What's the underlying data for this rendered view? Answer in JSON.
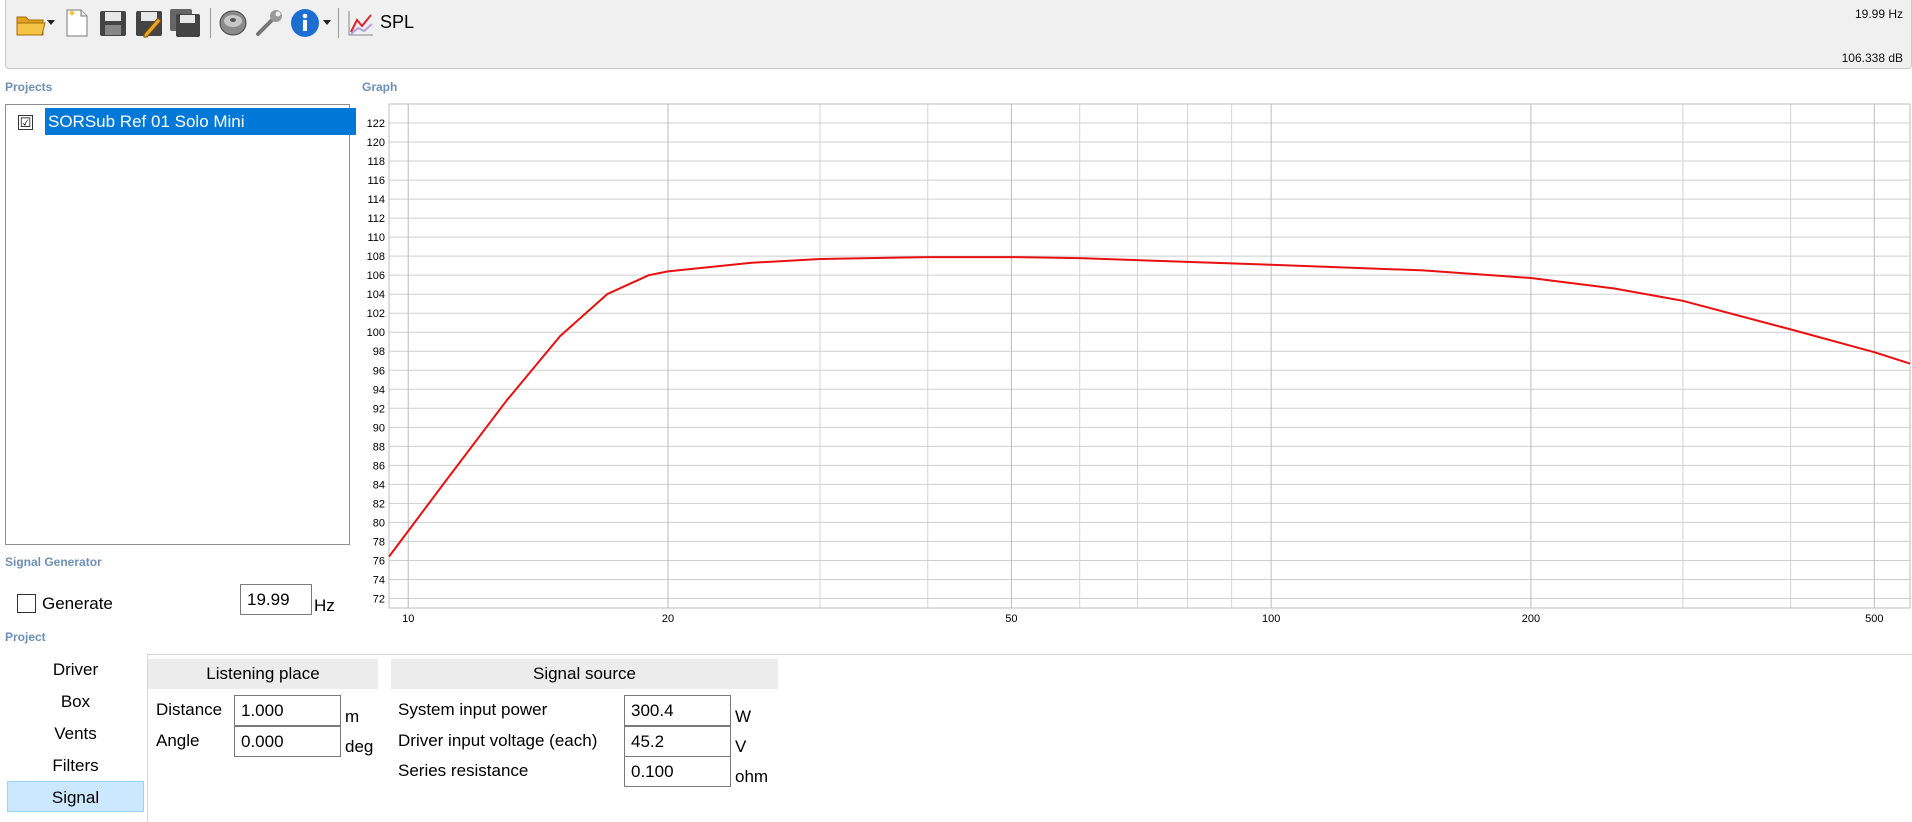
{
  "toolbar": {
    "icons": [
      "open-folder-icon",
      "new-document-icon",
      "save-icon",
      "save-as-icon",
      "save-all-icon",
      "speaker-driver-icon",
      "wrench-icon",
      "info-icon",
      "spl-graph-icon"
    ],
    "spl_label": "SPL",
    "readout_hz": "19.99 Hz",
    "readout_db": "106.338 dB"
  },
  "sections": {
    "projects": "Projects",
    "graph": "Graph",
    "signal_generator": "Signal Generator",
    "project": "Project"
  },
  "projects": {
    "items": [
      {
        "name": "SORSub Ref 01 Solo Mini",
        "checked": true,
        "check_mark": "☑"
      }
    ]
  },
  "signal_generator": {
    "generate_label": "Generate",
    "generate_checked": false,
    "frequency": "19.99",
    "frequency_unit": "Hz"
  },
  "project_nav": {
    "items": [
      "Driver",
      "Box",
      "Vents",
      "Filters",
      "Signal"
    ],
    "active": "Signal"
  },
  "listening_place": {
    "title": "Listening place",
    "distance_label": "Distance",
    "distance_value": "1.000",
    "distance_unit": "m",
    "angle_label": "Angle",
    "angle_value": "0.000",
    "angle_unit": "deg"
  },
  "signal_source": {
    "title": "Signal source",
    "power_label": "System input power",
    "power_value": "300.4",
    "power_unit": "W",
    "voltage_label": "Driver input voltage (each)",
    "voltage_value": "45.2",
    "voltage_unit": "V",
    "resistance_label": "Series resistance",
    "resistance_value": "0.100",
    "resistance_unit": "ohm"
  },
  "colors": {
    "curve": "#e81010",
    "selection": "#0078d7",
    "section_label": "#6d8fb8",
    "active_nav": "#cce8ff"
  },
  "chart_data": {
    "type": "line",
    "x_scale": "log",
    "xlim": [
      9.5,
      550
    ],
    "ylim": [
      71,
      124
    ],
    "x_ticks": [
      10,
      20,
      50,
      100,
      200,
      500
    ],
    "y_ticks": [
      72,
      74,
      76,
      78,
      80,
      82,
      84,
      86,
      88,
      90,
      92,
      94,
      96,
      98,
      100,
      102,
      104,
      106,
      108,
      110,
      112,
      114,
      116,
      118,
      120,
      122
    ],
    "grid": true,
    "series": [
      {
        "x": [
          9.5,
          11,
          13,
          15,
          17,
          19,
          20,
          25,
          30,
          40,
          50,
          60,
          80,
          100,
          150,
          200,
          250,
          300,
          400,
          500,
          550
        ],
        "y": [
          76.4,
          84.1,
          92.8,
          99.6,
          104.0,
          106.0,
          106.4,
          107.3,
          107.7,
          107.9,
          107.9,
          107.8,
          107.4,
          107.1,
          106.5,
          105.7,
          104.6,
          103.3,
          100.3,
          97.9,
          96.7
        ]
      }
    ]
  }
}
